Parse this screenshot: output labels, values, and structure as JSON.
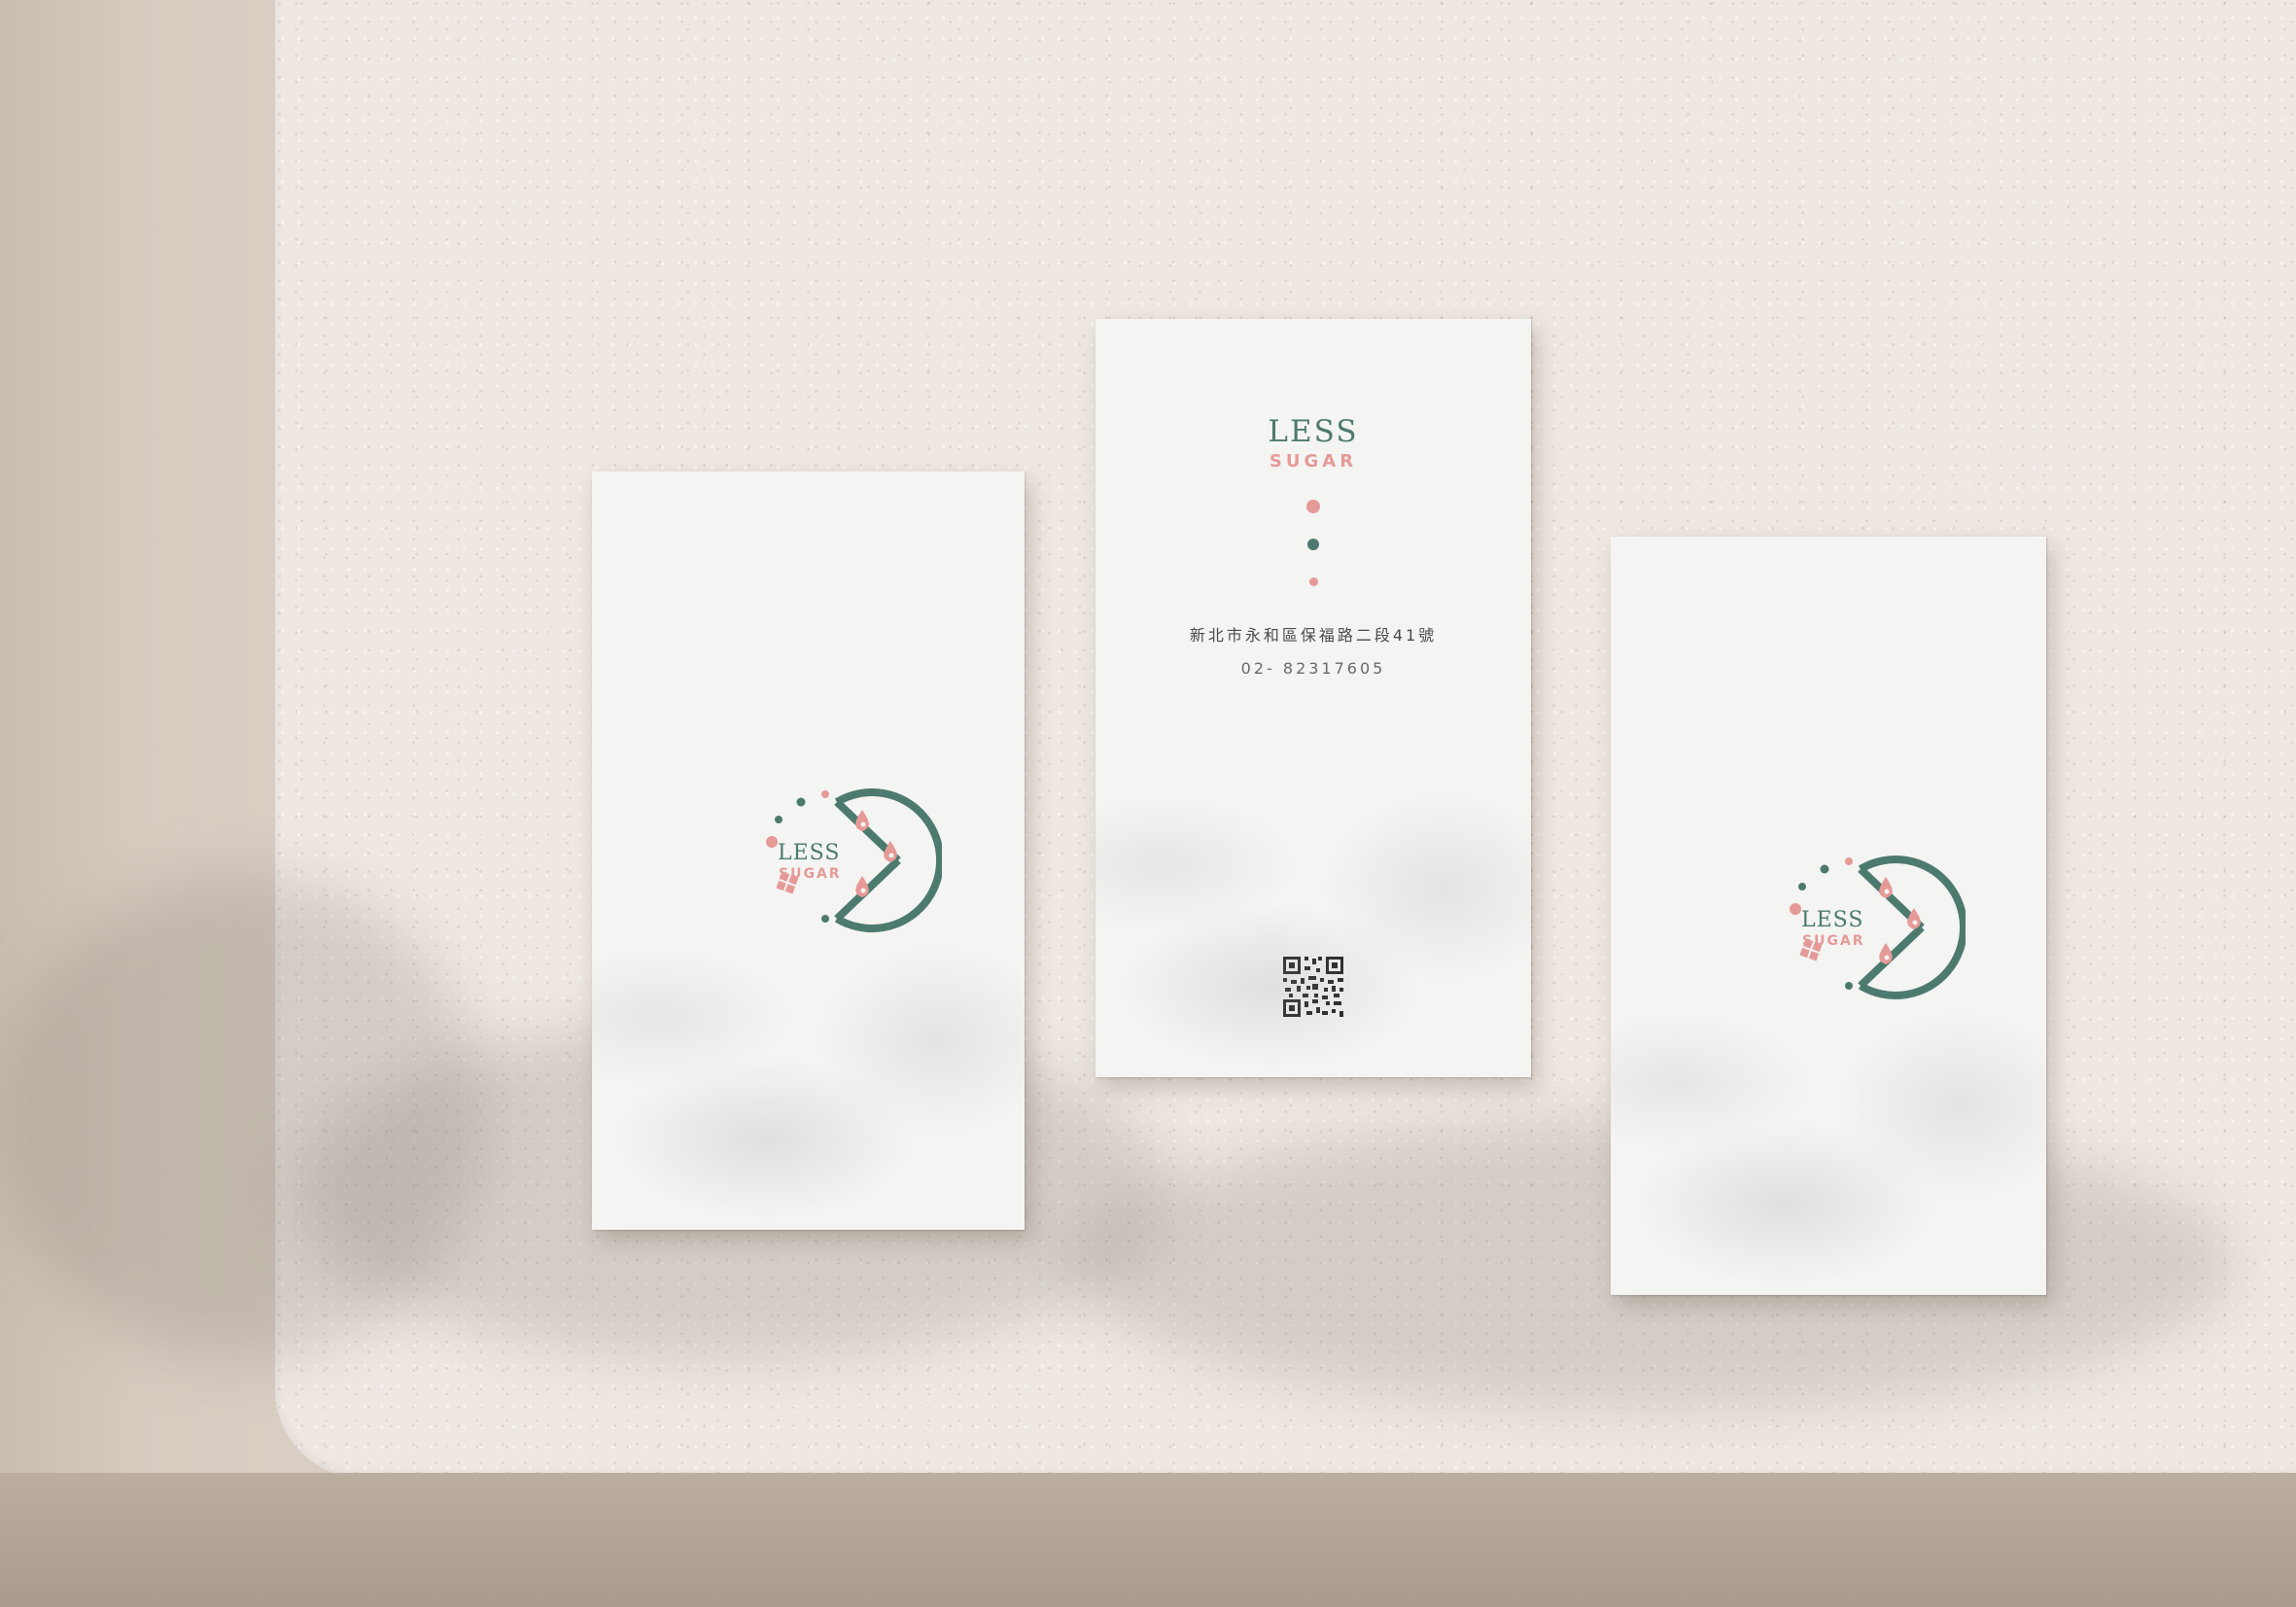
{
  "brand": {
    "line1": "LESS",
    "line2": "SUGAR"
  },
  "contact": {
    "address": "新北市永和區保福路二段41號",
    "phone": "02- 82317605"
  },
  "colors": {
    "brand_green": "#4d7a6e",
    "brand_pink": "#e59a97",
    "card_white": "#f4f4f3",
    "table_surface": "#efe8e2"
  },
  "icons": [
    "logo-circle-icon",
    "water-drop-icon",
    "sugar-cube-icon",
    "qr-code-icon"
  ]
}
